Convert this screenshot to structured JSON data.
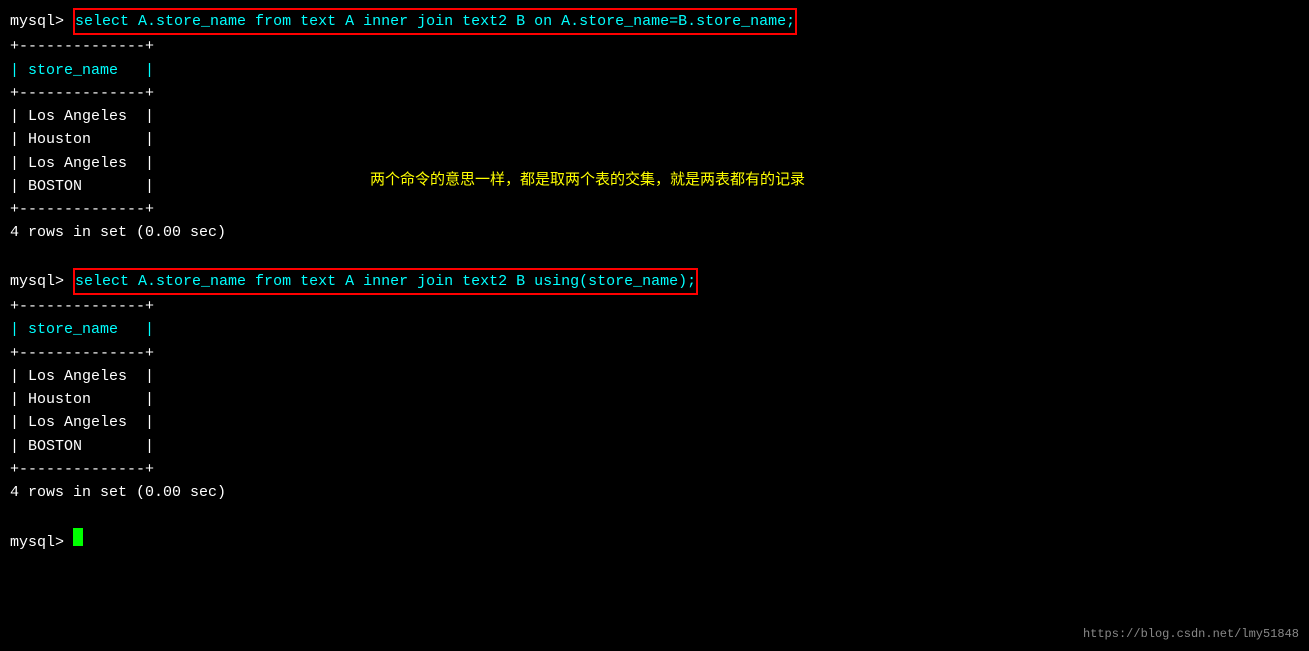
{
  "terminal": {
    "prompt1": {
      "label": "mysql>",
      "command": "select A.store_name from text A inner join text2 B on A.store_name=B.store_name;"
    },
    "table1": {
      "border_top": "+--------------+",
      "header": "| store_name   |",
      "border_mid": "+--------------+",
      "rows": [
        "| Los Angeles  |",
        "| Houston      |",
        "| Los Angeles  |",
        "| BOSTON       |"
      ],
      "border_bot": "+--------------+"
    },
    "result1": "4 rows in set (0.00 sec)",
    "annotation": "两个命令的意思一样，都是取两个表的交集，就是两表都有的记录",
    "prompt2": {
      "label": "mysql>",
      "command": "select A.store_name from text A inner join text2 B using(store_name);"
    },
    "table2": {
      "border_top": "+--------------+",
      "header": "| store_name   |",
      "border_mid": "+--------------+",
      "rows": [
        "| Los Angeles  |",
        "| Houston      |",
        "| Los Angeles  |",
        "| BOSTON       |"
      ],
      "border_bot": "+--------------+"
    },
    "result2": "4 rows in set (0.00 sec)",
    "prompt3": {
      "label": "mysql>"
    },
    "watermark": "https://blog.csdn.net/lmy51848"
  }
}
